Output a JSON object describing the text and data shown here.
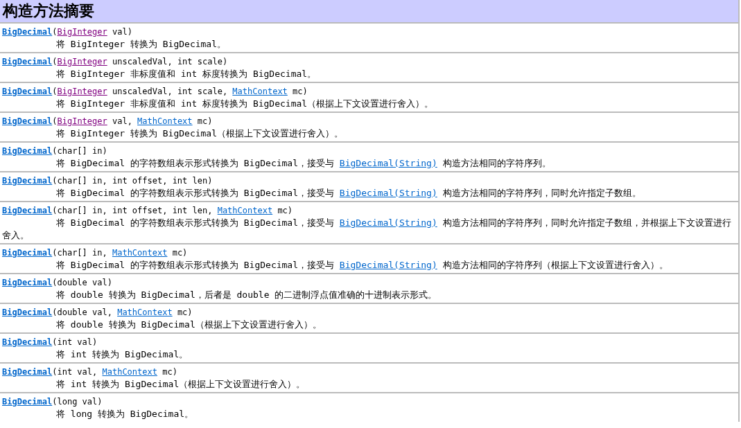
{
  "section_title": "构造方法摘要",
  "constructors": [
    {
      "signature": [
        {
          "kind": "name-link",
          "text": "BigDecimal"
        },
        {
          "kind": "text",
          "text": "("
        },
        {
          "kind": "visited-link",
          "text": "BigInteger"
        },
        {
          "kind": "text",
          "text": " val)"
        }
      ],
      "description": [
        {
          "kind": "text",
          "text": "将 BigInteger 转换为 BigDecimal。"
        }
      ]
    },
    {
      "signature": [
        {
          "kind": "name-link",
          "text": "BigDecimal"
        },
        {
          "kind": "text",
          "text": "("
        },
        {
          "kind": "visited-link",
          "text": "BigInteger"
        },
        {
          "kind": "text",
          "text": " unscaledVal, int scale)"
        }
      ],
      "description": [
        {
          "kind": "text",
          "text": "将 BigInteger 非标度值和 int 标度转换为 BigDecimal。"
        }
      ]
    },
    {
      "signature": [
        {
          "kind": "name-link",
          "text": "BigDecimal"
        },
        {
          "kind": "text",
          "text": "("
        },
        {
          "kind": "visited-link",
          "text": "BigInteger"
        },
        {
          "kind": "text",
          "text": " unscaledVal, int scale, "
        },
        {
          "kind": "link",
          "text": "MathContext"
        },
        {
          "kind": "text",
          "text": " mc)"
        }
      ],
      "description": [
        {
          "kind": "text",
          "text": "将 BigInteger 非标度值和 int 标度转换为 BigDecimal（根据上下文设置进行舍入）。"
        }
      ]
    },
    {
      "signature": [
        {
          "kind": "name-link",
          "text": "BigDecimal"
        },
        {
          "kind": "text",
          "text": "("
        },
        {
          "kind": "visited-link",
          "text": "BigInteger"
        },
        {
          "kind": "text",
          "text": " val, "
        },
        {
          "kind": "link",
          "text": "MathContext"
        },
        {
          "kind": "text",
          "text": " mc)"
        }
      ],
      "description": [
        {
          "kind": "text",
          "text": "将 BigInteger 转换为 BigDecimal（根据上下文设置进行舍入）。"
        }
      ]
    },
    {
      "signature": [
        {
          "kind": "name-link",
          "text": "BigDecimal"
        },
        {
          "kind": "text",
          "text": "(char[] in)"
        }
      ],
      "description": [
        {
          "kind": "text",
          "text": "将 BigDecimal 的字符数组表示形式转换为 BigDecimal，接受与 "
        },
        {
          "kind": "link",
          "text": "BigDecimal(String)"
        },
        {
          "kind": "text",
          "text": " 构造方法相同的字符序列。"
        }
      ]
    },
    {
      "signature": [
        {
          "kind": "name-link",
          "text": "BigDecimal"
        },
        {
          "kind": "text",
          "text": "(char[] in, int offset, int len)"
        }
      ],
      "description": [
        {
          "kind": "text",
          "text": "将 BigDecimal 的字符数组表示形式转换为 BigDecimal，接受与 "
        },
        {
          "kind": "link",
          "text": "BigDecimal(String)"
        },
        {
          "kind": "text",
          "text": " 构造方法相同的字符序列，同时允许指定子数组。"
        }
      ]
    },
    {
      "signature": [
        {
          "kind": "name-link",
          "text": "BigDecimal"
        },
        {
          "kind": "text",
          "text": "(char[] in, int offset, int len, "
        },
        {
          "kind": "link",
          "text": "MathContext"
        },
        {
          "kind": "text",
          "text": " mc)"
        }
      ],
      "description": [
        {
          "kind": "text",
          "text": "将 BigDecimal 的字符数组表示形式转换为 BigDecimal，接受与 "
        },
        {
          "kind": "link",
          "text": "BigDecimal(String)"
        },
        {
          "kind": "text",
          "text": " 构造方法相同的字符序列，同时允许指定子数组，并根据上下文设置进行舍入。"
        }
      ]
    },
    {
      "signature": [
        {
          "kind": "name-link",
          "text": "BigDecimal"
        },
        {
          "kind": "text",
          "text": "(char[] in, "
        },
        {
          "kind": "link",
          "text": "MathContext"
        },
        {
          "kind": "text",
          "text": " mc)"
        }
      ],
      "description": [
        {
          "kind": "text",
          "text": "将 BigDecimal 的字符数组表示形式转换为 BigDecimal，接受与 "
        },
        {
          "kind": "link",
          "text": "BigDecimal(String)"
        },
        {
          "kind": "text",
          "text": " 构造方法相同的字符序列（根据上下文设置进行舍入）。"
        }
      ]
    },
    {
      "signature": [
        {
          "kind": "name-link",
          "text": "BigDecimal"
        },
        {
          "kind": "text",
          "text": "(double val)"
        }
      ],
      "description": [
        {
          "kind": "text",
          "text": "将 double 转换为 BigDecimal，后者是 double 的二进制浮点值准确的十进制表示形式。"
        }
      ]
    },
    {
      "signature": [
        {
          "kind": "name-link",
          "text": "BigDecimal"
        },
        {
          "kind": "text",
          "text": "(double val, "
        },
        {
          "kind": "link",
          "text": "MathContext"
        },
        {
          "kind": "text",
          "text": " mc)"
        }
      ],
      "description": [
        {
          "kind": "text",
          "text": "将 double 转换为 BigDecimal（根据上下文设置进行舍入）。"
        }
      ]
    },
    {
      "signature": [
        {
          "kind": "name-link",
          "text": "BigDecimal"
        },
        {
          "kind": "text",
          "text": "(int val)"
        }
      ],
      "description": [
        {
          "kind": "text",
          "text": "将 int 转换为 BigDecimal。"
        }
      ]
    },
    {
      "signature": [
        {
          "kind": "name-link",
          "text": "BigDecimal"
        },
        {
          "kind": "text",
          "text": "(int val, "
        },
        {
          "kind": "link",
          "text": "MathContext"
        },
        {
          "kind": "text",
          "text": " mc)"
        }
      ],
      "description": [
        {
          "kind": "text",
          "text": "将 int 转换为 BigDecimal（根据上下文设置进行舍入）。"
        }
      ]
    },
    {
      "signature": [
        {
          "kind": "name-link",
          "text": "BigDecimal"
        },
        {
          "kind": "text",
          "text": "(long val)"
        }
      ],
      "description": [
        {
          "kind": "text",
          "text": "将 long 转换为 BigDecimal。"
        }
      ]
    }
  ]
}
